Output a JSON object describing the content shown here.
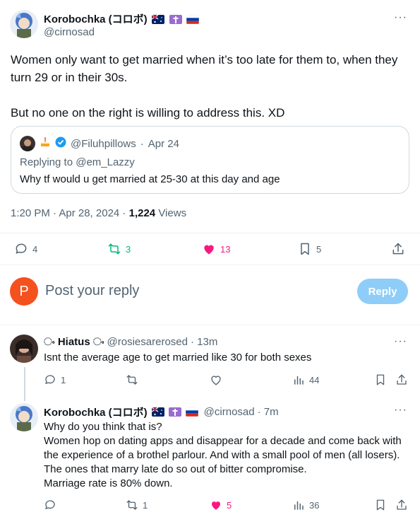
{
  "main_tweet": {
    "author_name": "Korobochka (コロボ)",
    "handle": "@cirnosad",
    "text_line1": "Women only want to get married when it’s too late for them to, when they",
    "text_line2": "turn 29 or in their 30s.",
    "text_line3": "But no one on the right is willing to address this. XD",
    "quote": {
      "handle": "@Filuhpillows",
      "date": "Apr 24",
      "replying_to": "Replying to @em_Lazzy",
      "text": "Why tf would u get married at 25-30 at this day and age"
    },
    "time": "1:20 PM · Apr 28, 2024 ·",
    "views_count": "1,224",
    "views_label": "Views",
    "actions": {
      "replies": "4",
      "retweets": "3",
      "likes": "13",
      "bookmarks": "5"
    }
  },
  "composer": {
    "avatar_letter": "P",
    "placeholder": "Post your reply",
    "button_label": "Reply"
  },
  "replies": [
    {
      "name": "ං Hiatus ං",
      "handle": "@rosiesarerosed",
      "time": "· 13m",
      "lines": [
        "Isnt the average age to get married like 30 for both sexes"
      ],
      "reply_count": "1",
      "retweet_count": "",
      "like_count": "",
      "view_count": "44"
    },
    {
      "name": "Korobochka (コロボ)",
      "handle": "@cirnosad",
      "time": "· 7m",
      "lines": [
        "Why do you think that is?",
        "Women hop on dating apps and disappear for a decade and come back with",
        "the experience of a brothel parlour. And with a small pool of men (all losers).",
        "The ones that marry late do so out of bitter compromise.",
        "Marriage rate is 80% down."
      ],
      "reply_count": "",
      "retweet_count": "1",
      "like_count": "5",
      "view_count": "36"
    }
  ],
  "colors": {
    "retweet_active": "#00ba7c",
    "like_active": "#f91880",
    "muted": "#536471",
    "reply_button": "#8ecdf8"
  }
}
